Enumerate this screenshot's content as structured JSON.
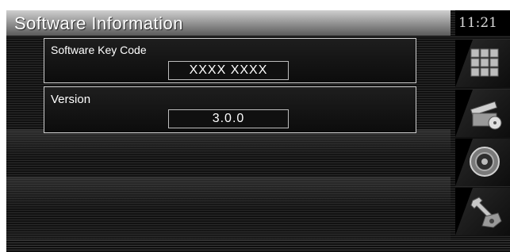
{
  "header": {
    "title": "Software Information",
    "clock": "11:21"
  },
  "panels": [
    {
      "label": "Software Key Code",
      "value": "XXXX XXXX"
    },
    {
      "label": "Version",
      "value": "3.0.0"
    }
  ],
  "sidebar": {
    "items": [
      {
        "icon": "grid-menu-icon"
      },
      {
        "icon": "media-icon"
      },
      {
        "icon": "speaker-icon"
      },
      {
        "icon": "wrench-settings-icon"
      }
    ]
  },
  "colors": {
    "title_bar_top": "#cfcfcf",
    "title_bar_bottom": "#5a5a5a",
    "background": "#0a0a0a",
    "text": "#ffffff"
  }
}
